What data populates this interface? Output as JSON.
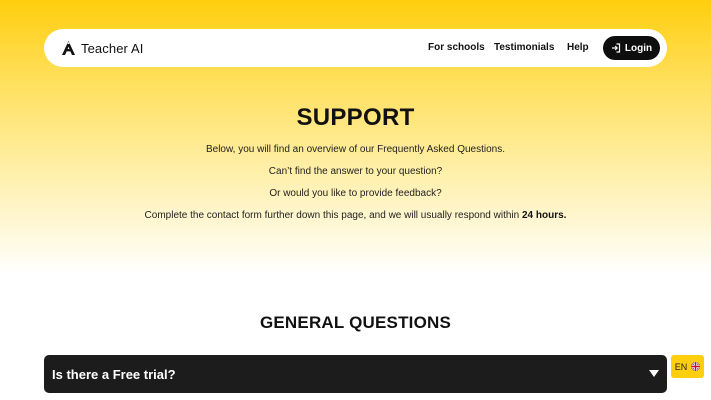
{
  "nav": {
    "brand": "Teacher AI",
    "links": [
      "For schools",
      "Testimonials",
      "Help"
    ],
    "login": "Login",
    "icons": [
      "teacher-ai-logo-icon",
      "login-arrow-icon"
    ]
  },
  "hero": {
    "title": "SUPPORT",
    "line1": "Below, you will find an overview of our Frequently Asked Questions.",
    "line2": "Can’t find the answer to your question?",
    "line3": "Or would you like to provide feedback?",
    "line4_prefix": "Complete the contact form further down this page, and we will usually respond within",
    "line4_bold": "24 hours."
  },
  "faq": {
    "section_title": "GENERAL QUESTIONS",
    "items": [
      {
        "question": "Is there a Free trial?"
      }
    ]
  },
  "language": {
    "code": "EN",
    "icon": "uk-flag-icon"
  },
  "colors": {
    "brand_yellow": "#FFCE0C",
    "dark": "#1C1C1C",
    "button_black": "#0E0E0E"
  }
}
